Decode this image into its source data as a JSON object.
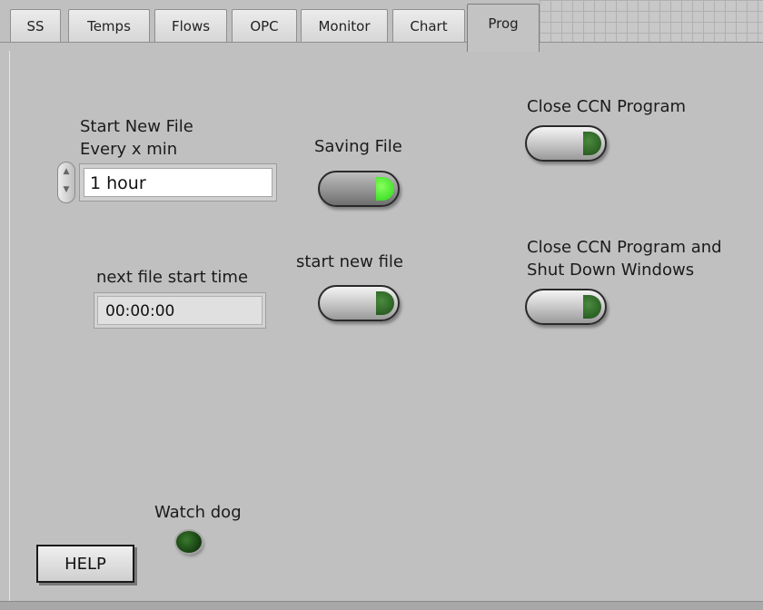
{
  "tabs": [
    {
      "label": "SS"
    },
    {
      "label": "Temps"
    },
    {
      "label": "Flows"
    },
    {
      "label": "OPC"
    },
    {
      "label": "Monitor"
    },
    {
      "label": "Chart"
    },
    {
      "label": "Prog",
      "active": true
    }
  ],
  "file_interval": {
    "label_line1": "Start New File",
    "label_line2": "Every x min",
    "value": "1 hour"
  },
  "saving_file": {
    "label": "Saving File",
    "state": "on"
  },
  "next_file": {
    "label": "next file start time",
    "value": "00:00:00"
  },
  "start_new_file": {
    "label": "start new file",
    "state": "off"
  },
  "close_program": {
    "label": "Close CCN Program",
    "state": "off"
  },
  "close_shutdown": {
    "label_line1": "Close CCN Program and",
    "label_line2": "Shut Down Windows",
    "state": "off"
  },
  "watchdog": {
    "label": "Watch dog"
  },
  "help": {
    "label": "HELP"
  },
  "colors": {
    "background": "#c0c0c0",
    "lamp_on": "#3ad61f",
    "lamp_off": "#1e4f19"
  }
}
